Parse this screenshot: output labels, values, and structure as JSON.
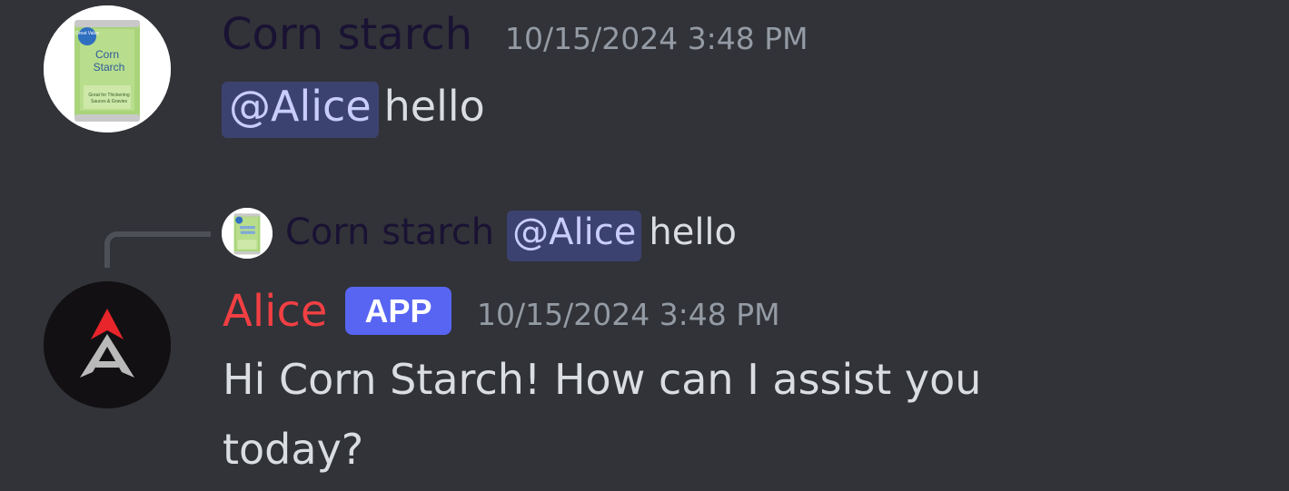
{
  "messages": [
    {
      "author": "Corn starch",
      "timestamp": "10/15/2024 3:48 PM",
      "avatar_icon": "corn-starch-can-icon",
      "mention": "@Alice",
      "text": "hello"
    },
    {
      "author": "Alice",
      "badge": "APP",
      "timestamp": "10/15/2024 3:48 PM",
      "avatar_icon": "alice-a-logo-icon",
      "reply_to": {
        "author": "Corn starch",
        "mention": "@Alice",
        "text": "hello"
      },
      "text": "Hi Corn Starch! How can I assist you today?"
    }
  ],
  "colors": {
    "background": "#313338",
    "corn_starch_name": "#1a1233",
    "alice_name": "#f23f43",
    "app_badge": "#5865f2",
    "mention_bg": "#3c4270",
    "mention_text": "#c9cdfb",
    "timestamp": "#949ba4",
    "message_text": "#dbdee1"
  },
  "product_label": {
    "brand": "Great Value",
    "name_line1": "Corn",
    "name_line2": "Starch",
    "tagline_line1": "Great for Thickening",
    "tagline_line2": "Sauces & Gravies"
  }
}
